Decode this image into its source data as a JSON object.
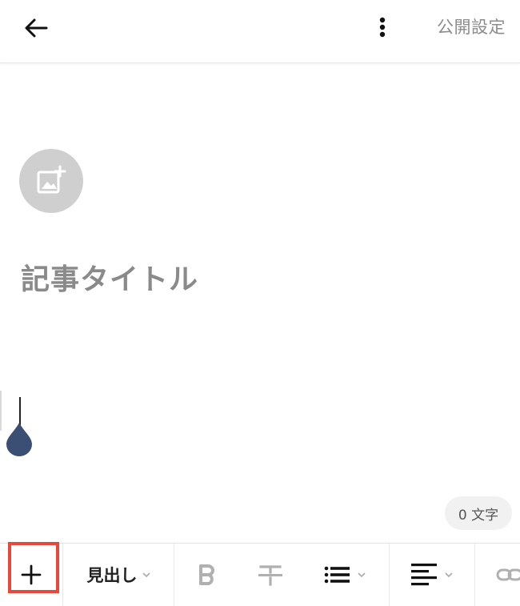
{
  "header": {
    "back_icon": "arrow-left-icon",
    "more_icon": "more-vertical-icon",
    "publish_label": "公開設定"
  },
  "editor": {
    "eyecatch_icon": "add-image-icon",
    "title_placeholder": "記事タイトル",
    "char_count": "0 文字"
  },
  "toolbar": {
    "add_icon": "plus-icon",
    "heading_label": "見出し",
    "bold_icon": "bold-icon",
    "strike_icon": "strikethrough-icon",
    "list_icon": "list-icon",
    "align_icon": "align-left-icon",
    "link_icon": "link-icon"
  },
  "colors": {
    "highlight": "#e8473b",
    "cursor_drop": "#3b4f75",
    "muted_text": "#8a8a8a"
  }
}
